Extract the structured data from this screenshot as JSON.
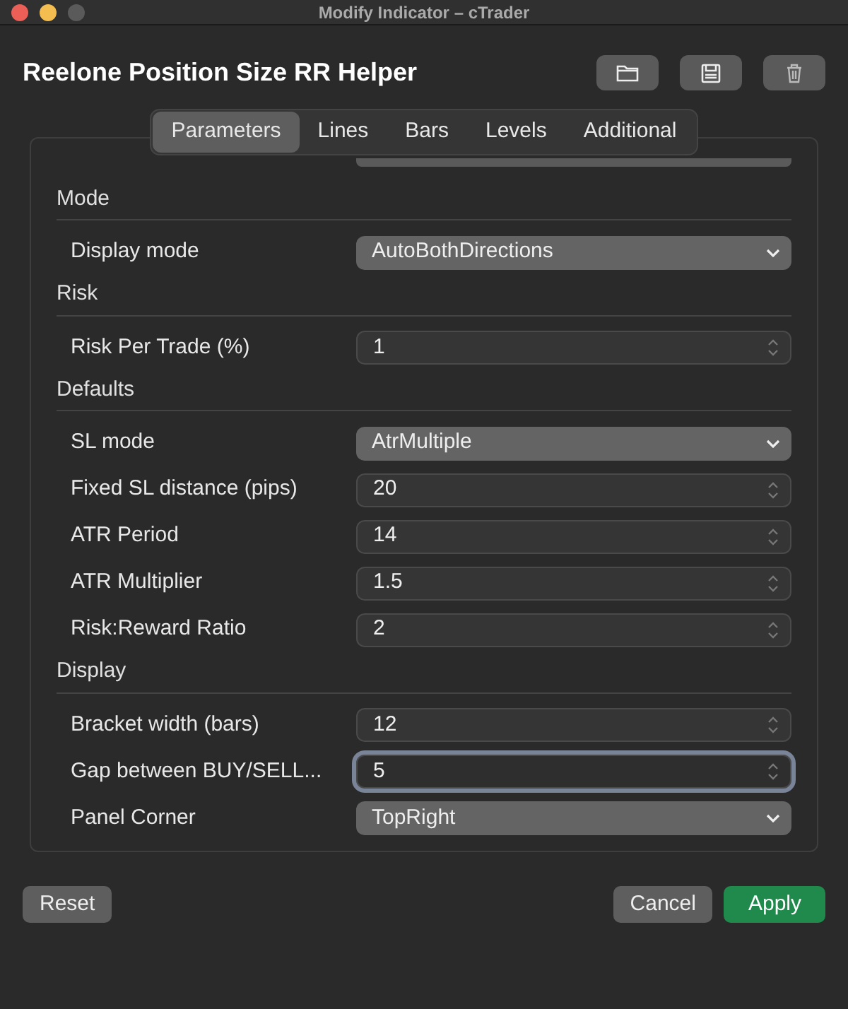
{
  "window": {
    "title": "Modify Indicator – cTrader"
  },
  "header": {
    "title": "Reelone Position Size RR Helper"
  },
  "tabs": [
    {
      "label": "Parameters",
      "selected": true
    },
    {
      "label": "Lines",
      "selected": false
    },
    {
      "label": "Bars",
      "selected": false
    },
    {
      "label": "Levels",
      "selected": false
    },
    {
      "label": "Additional",
      "selected": false
    }
  ],
  "sections": [
    {
      "title": "Mode",
      "rows": [
        {
          "label": "Display mode",
          "kind": "select",
          "value": "AutoBothDirections",
          "focused": false
        }
      ]
    },
    {
      "title": "Risk",
      "rows": [
        {
          "label": "Risk Per Trade (%)",
          "kind": "number",
          "value": "1",
          "focused": false
        }
      ]
    },
    {
      "title": "Defaults",
      "rows": [
        {
          "label": "SL mode",
          "kind": "select",
          "value": "AtrMultiple",
          "focused": false
        },
        {
          "label": "Fixed SL distance (pips)",
          "kind": "number",
          "value": "20",
          "focused": false
        },
        {
          "label": "ATR Period",
          "kind": "number",
          "value": "14",
          "focused": false
        },
        {
          "label": "ATR Multiplier",
          "kind": "number",
          "value": "1.5",
          "focused": false
        },
        {
          "label": "Risk:Reward Ratio",
          "kind": "number",
          "value": "2",
          "focused": false
        }
      ]
    },
    {
      "title": "Display",
      "rows": [
        {
          "label": "Bracket width (bars)",
          "kind": "number",
          "value": "12",
          "focused": false
        },
        {
          "label": "Gap between BUY/SELL...",
          "kind": "number",
          "value": "5",
          "focused": true
        },
        {
          "label": "Panel Corner",
          "kind": "select",
          "value": "TopRight",
          "focused": false
        }
      ]
    }
  ],
  "footer": {
    "reset": "Reset",
    "cancel": "Cancel",
    "apply": "Apply"
  }
}
